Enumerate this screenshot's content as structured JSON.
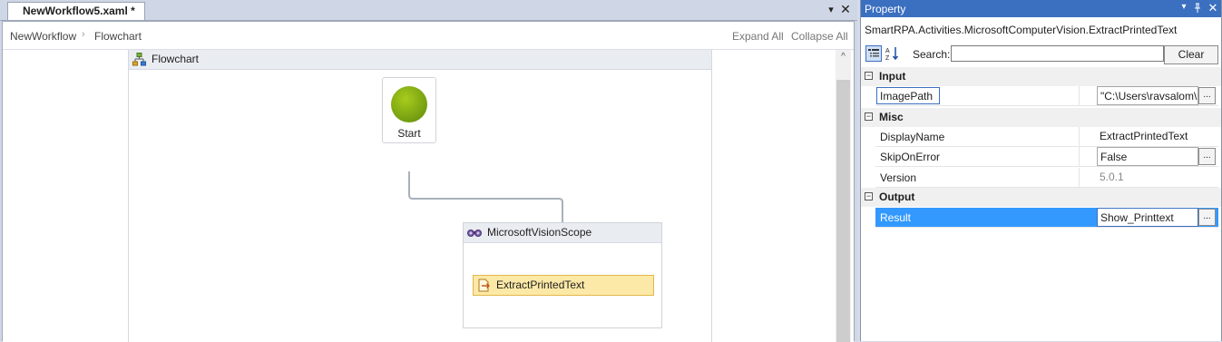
{
  "designer": {
    "tab_title": "NewWorkflow5.xaml *",
    "tab_menu_icon": "▾",
    "tab_close_icon": "✕",
    "breadcrumb": [
      "NewWorkflow",
      "Flowchart"
    ],
    "breadcrumb_separator": "›",
    "expand_all": "Expand All",
    "collapse_all": "Collapse All",
    "flowchart_title": "Flowchart",
    "start_label": "Start",
    "scope_title": "MicrosoftVisionScope",
    "activity_label": "ExtractPrintedText",
    "scroll_up_icon": "^"
  },
  "property": {
    "pane_title": "Property",
    "pane_menu_icon": "▾",
    "pane_pin_icon": "ᵖ",
    "pane_close_icon": "✕",
    "type_name": "SmartRPA.Activities.MicrosoftComputerVision.ExtractPrintedText",
    "search_label": "Search:",
    "search_value": "",
    "clear_label": "Clear",
    "categories": {
      "input": "Input",
      "misc": "Misc",
      "output": "Output"
    },
    "rows": {
      "imagepath": {
        "name": "ImagePath",
        "value": "\"C:\\Users\\ravsalom\\De"
      },
      "displayname": {
        "name": "DisplayName",
        "value": "ExtractPrintedText"
      },
      "skiponerror": {
        "name": "SkipOnError",
        "value": "False"
      },
      "version": {
        "name": "Version",
        "value": "5.0.1"
      },
      "result": {
        "name": "Result",
        "value": "Show_Printtext"
      }
    },
    "ellipsis_label": "...",
    "toggle_label": "−"
  },
  "colors": {
    "accent": "#3b6fc0",
    "selected_row": "#3399ff",
    "start_node": "#8db515",
    "activity_fill": "#fde9a7"
  }
}
